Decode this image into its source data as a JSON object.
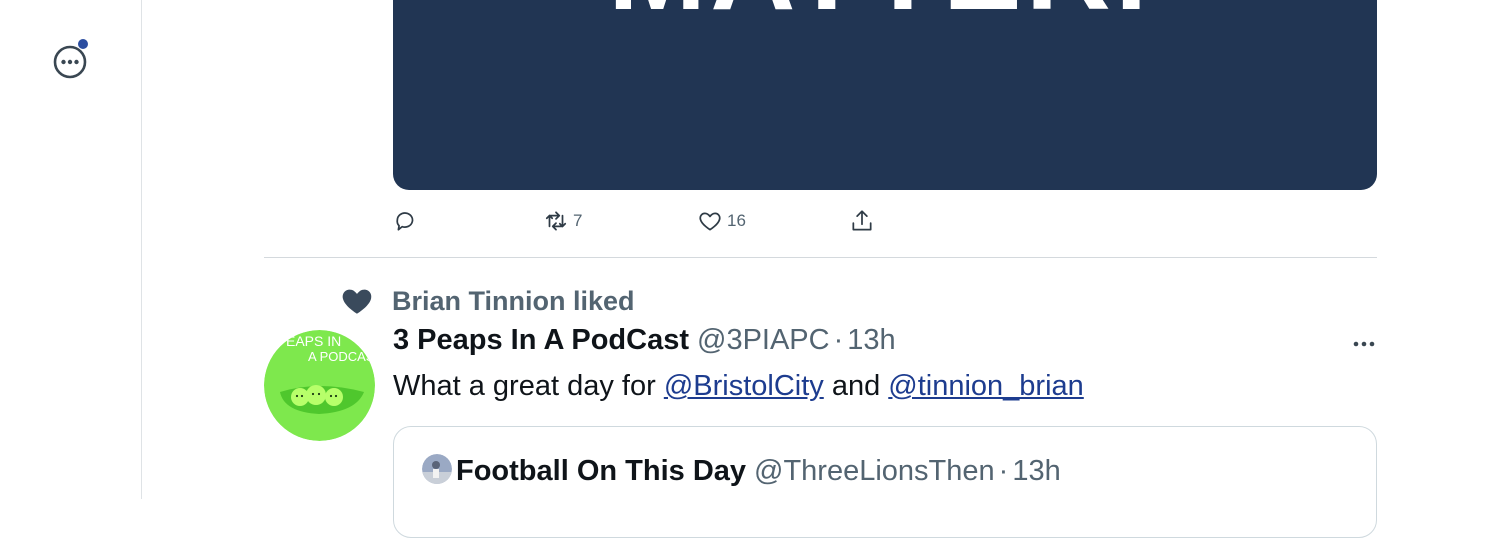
{
  "media": {
    "overlay_text": "MATTER."
  },
  "actions": {
    "reply_count": "",
    "retweet_count": "7",
    "like_count": "16"
  },
  "social_context": {
    "text": "Brian Tinnion liked"
  },
  "tweet": {
    "author_name": "3 Peaps In A PodCast",
    "author_handle": "@3PIAPC",
    "separator": "·",
    "time": "13h",
    "avatar_text_line1": "EAPS IN",
    "avatar_text_line2": "A PODCAS",
    "body": {
      "prefix": "What a great day for ",
      "mention1": "@BristolCity",
      "conjunction": " and ",
      "mention2": "@tinnion_brian"
    }
  },
  "quote": {
    "author_name": "Football On This Day",
    "author_handle": "@ThreeLionsThen",
    "separator": "·",
    "time": "13h"
  },
  "colors": {
    "media_bg": "#213553",
    "link": "#1d3c8f",
    "muted": "#536471",
    "notification_dot": "#2b4da0",
    "avatar_green": "#7ee84d"
  }
}
